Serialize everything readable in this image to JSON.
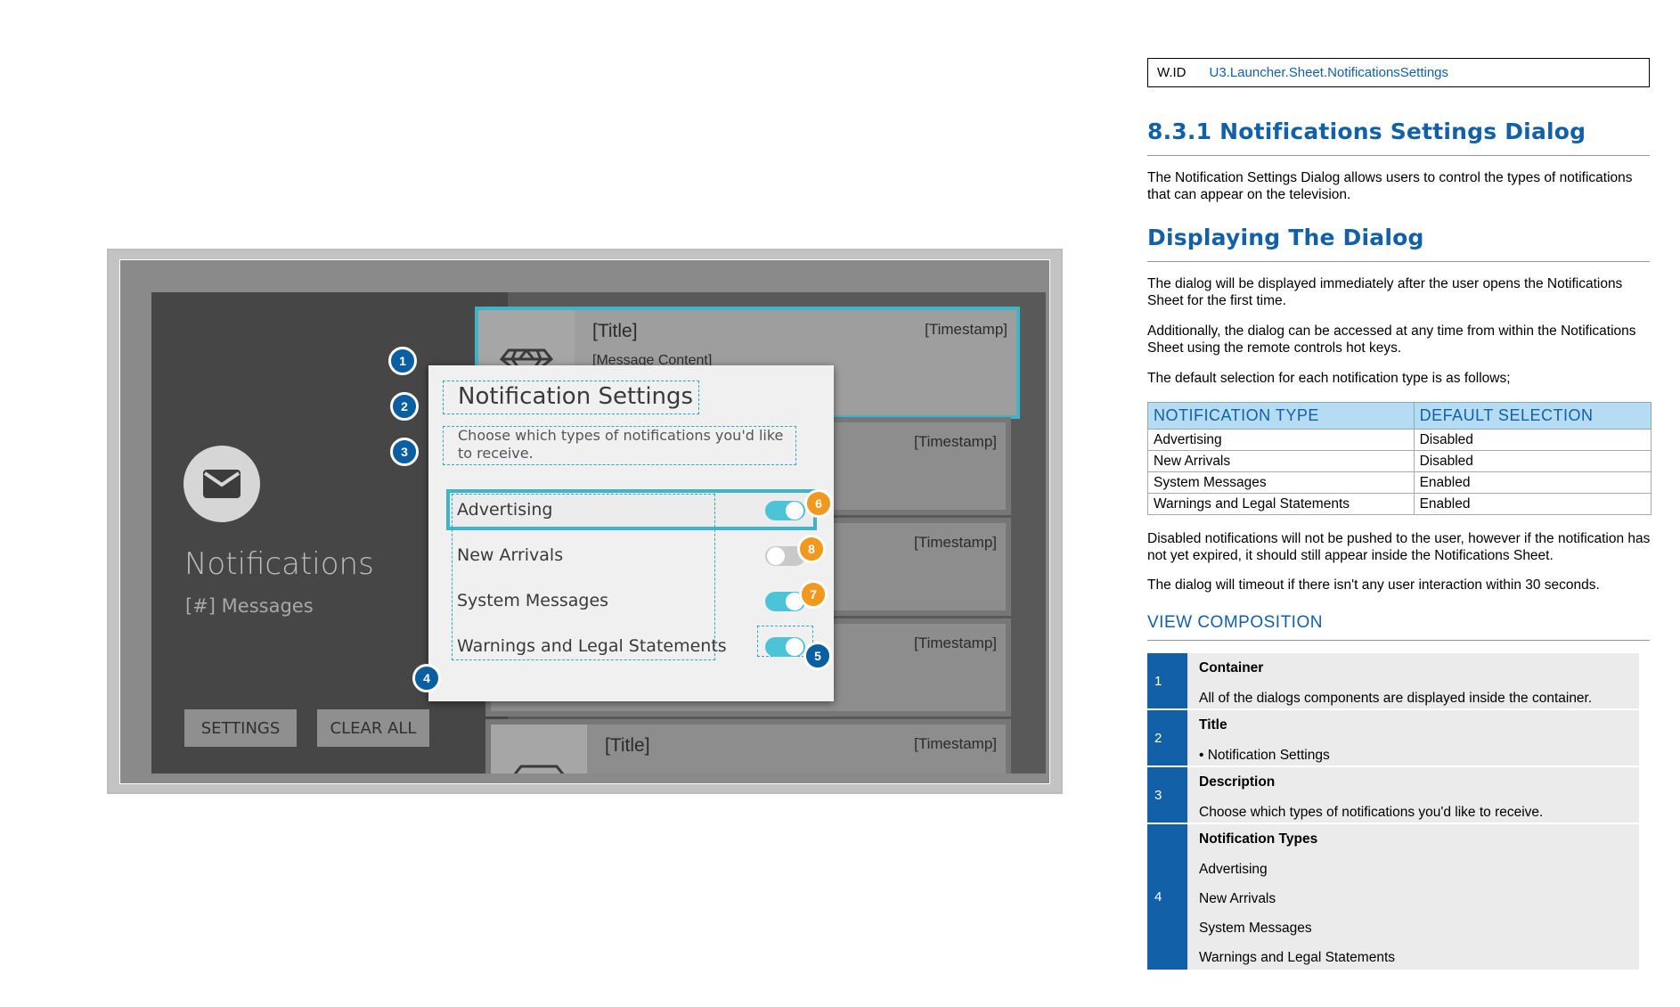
{
  "mockup": {
    "sheet_title": "Notifications",
    "sheet_count": "[#] Messages",
    "settings_label": "SETTINGS",
    "clear_label": "CLEAR ALL",
    "cards": [
      {
        "title": "[Title]",
        "message": "[Message Content]",
        "timestamp": "[Timestamp]"
      },
      {
        "title": "",
        "message": "",
        "timestamp": "[Timestamp]"
      },
      {
        "title": "",
        "message": "",
        "timestamp": "[Timestamp]"
      },
      {
        "title": "",
        "message": "",
        "timestamp": "[Timestamp]"
      },
      {
        "title": "[Title]",
        "message": "",
        "timestamp": "[Timestamp]"
      }
    ],
    "dialog": {
      "title": "Notification Settings",
      "description": "Choose which types of notifications you'd like to receive.",
      "options": [
        {
          "label": "Advertising",
          "on": true
        },
        {
          "label": "New Arrivals",
          "on": false
        },
        {
          "label": "System Messages",
          "on": true
        },
        {
          "label": "Warnings and Legal Statements",
          "on": true
        }
      ]
    },
    "badges": [
      "1",
      "2",
      "3",
      "4",
      "5",
      "6",
      "7",
      "8"
    ],
    "colors": {
      "accent": "#3fb4c8",
      "badge_blue": "#0a5fa3",
      "badge_orange": "#f0991e"
    }
  },
  "doc": {
    "wid_key": "W.ID",
    "wid_value": "U3.Launcher.Sheet.NotificationsSettings",
    "heading1": "8.3.1  Notifications Settings Dialog",
    "intro": "The Notification Settings Dialog allows users to control the types of notifications that can appear on the television.",
    "heading2": "Displaying The Dialog",
    "para1": "The dialog will be displayed immediately after the user opens the Notifications Sheet for the first time.",
    "para2": "Additionally, the dialog can be accessed at any time from within the Notifications Sheet using the remote controls hot keys.",
    "para3": "The default selection for each notification type is as follows;",
    "table": {
      "headers": [
        "NOTIFICATION TYPE",
        "DEFAULT SELECTION"
      ],
      "rows": [
        [
          "Advertising",
          "Disabled"
        ],
        [
          "New Arrivals",
          "Disabled"
        ],
        [
          "System Messages",
          "Enabled"
        ],
        [
          "Warnings and Legal Statements",
          "Enabled"
        ]
      ]
    },
    "para4": "Disabled notifications will not be pushed to the user, however if the notification has not yet expired, it should still appear inside the Notifications Sheet.",
    "para5": "The dialog will timeout if there isn't any user interaction within 30 seconds.",
    "view_heading": "VIEW COMPOSITION",
    "composition": [
      {
        "num": "1",
        "title": "Container",
        "lines": [
          "All of the dialogs components are displayed inside the container."
        ]
      },
      {
        "num": "2",
        "title": "Title",
        "lines": [
          "•     Notification Settings"
        ]
      },
      {
        "num": "3",
        "title": "Description",
        "lines": [
          "Choose which types of notifications you'd like to receive."
        ]
      },
      {
        "num": "4",
        "title": "Notification Types",
        "lines": [
          "Advertising",
          "New Arrivals",
          "System Messages",
          "Warnings and Legal Statements"
        ]
      }
    ]
  }
}
